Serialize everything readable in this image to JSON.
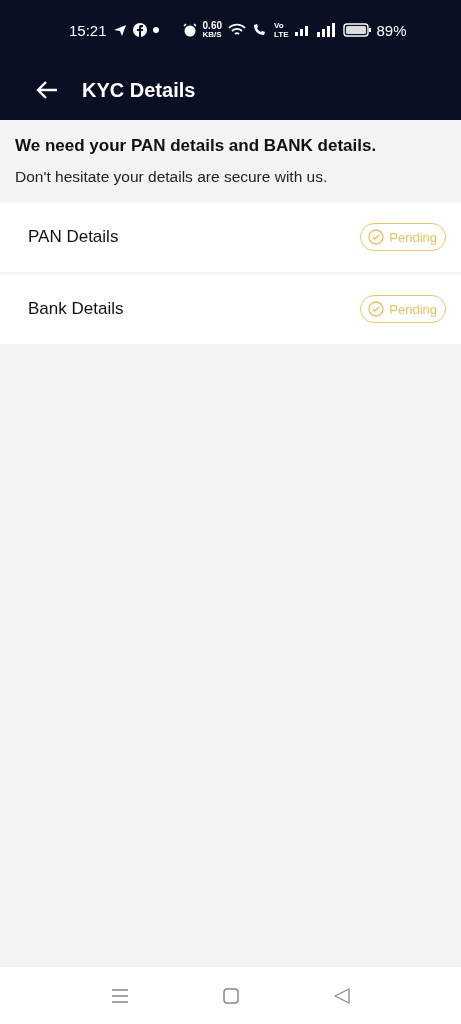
{
  "status_bar": {
    "time": "15:21",
    "speed": "0.60",
    "speed_unit": "KB/S",
    "volte_top": "Vo",
    "volte_bottom": "LTE",
    "battery": "89%"
  },
  "header": {
    "title": "KYC Details"
  },
  "intro": {
    "heading": "We need your PAN details and BANK details.",
    "text": "Don't hesitate your details are secure with us."
  },
  "items": [
    {
      "label": "PAN Details",
      "status": "Pending"
    },
    {
      "label": "Bank Details",
      "status": "Pending"
    }
  ]
}
